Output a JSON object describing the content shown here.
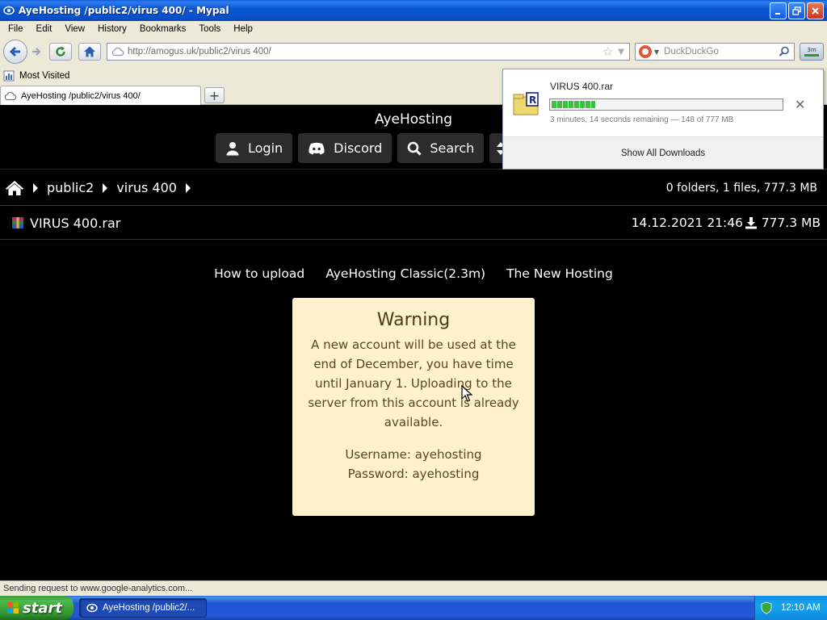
{
  "window": {
    "title": "AyeHosting /public2/virus 400/ - Mypal"
  },
  "menu": [
    "File",
    "Edit",
    "View",
    "History",
    "Bookmarks",
    "Tools",
    "Help"
  ],
  "navbar": {
    "url": "http://amogus.uk/public2/virus 400/",
    "search_placeholder": "DuckDuckGo",
    "download_button_time": "3m"
  },
  "bookmarks": {
    "most_visited": "Most Visited"
  },
  "tab": {
    "title": "AyeHosting /public2/virus 400/"
  },
  "site": {
    "title": "AyeHosting",
    "nav": {
      "login": "Login",
      "discord": "Discord",
      "search": "Search"
    },
    "breadcrumb": {
      "items": [
        "public2",
        "virus 400"
      ],
      "summary": "0 folders, 1 files, 777.3 MB"
    },
    "file": {
      "name": "VIRUS 400.rar",
      "date": "14.12.2021 21:46",
      "size": "777.3 MB"
    },
    "links": [
      "How to upload",
      "AyeHosting Classic(2.3m)",
      "The New Hosting"
    ],
    "warning": {
      "title": "Warning",
      "message": "A new account will be used at the end of December, you have time until January 1. Uploading to the server from this account is already available.",
      "username": "Username: ayehosting",
      "password": "Password: ayehosting"
    }
  },
  "downloads_panel": {
    "file_name": "VIRUS 400.rar",
    "progress_fraction": 0.19,
    "status": "3 minutes, 14 seconds remaining — 148 of 777 MB",
    "show_all": "Show All Downloads"
  },
  "statusbar": {
    "text": "Sending request to www.google-analytics.com..."
  },
  "taskbar": {
    "start": "start",
    "task_title": "AyeHosting /public2/...",
    "clock": "12:10 AM"
  }
}
